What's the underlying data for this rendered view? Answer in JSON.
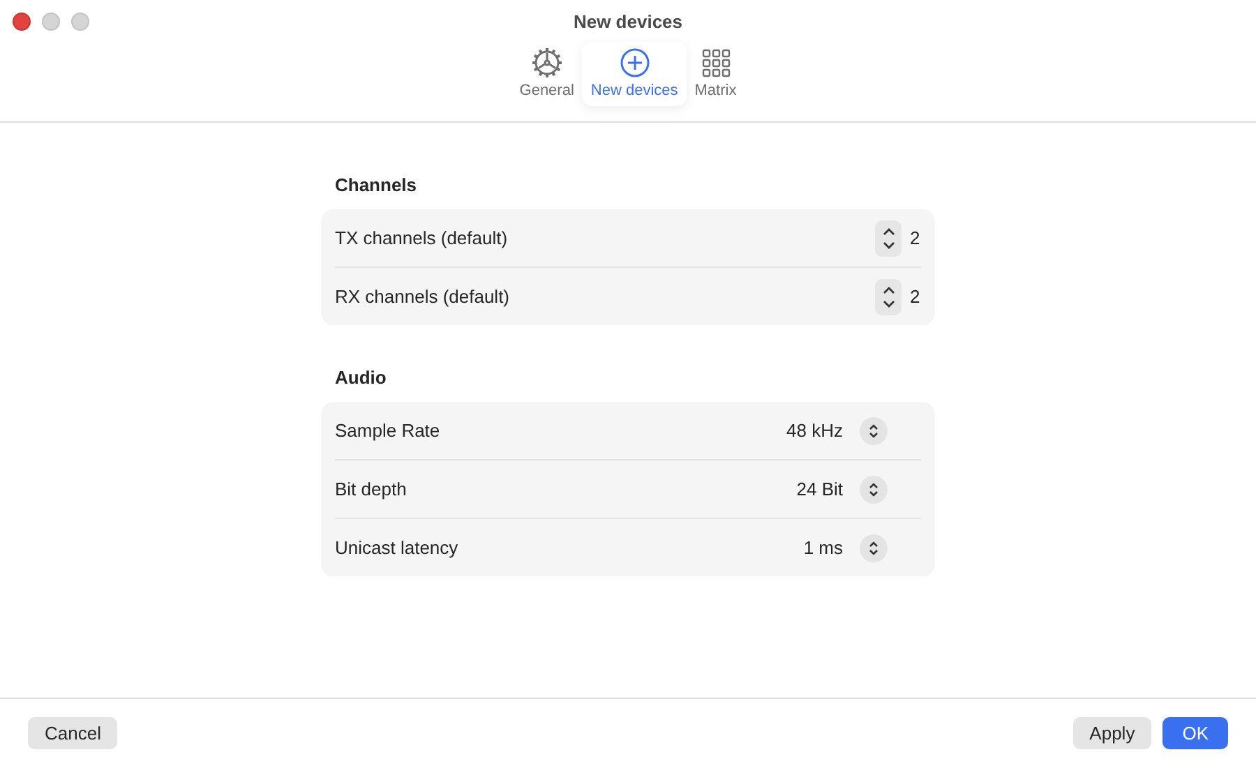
{
  "window": {
    "title": "New devices"
  },
  "tabs": [
    {
      "label": "General",
      "selected": false
    },
    {
      "label": "New devices",
      "selected": true
    },
    {
      "label": "Matrix",
      "selected": false
    }
  ],
  "sections": [
    {
      "title": "Channels",
      "rows": [
        {
          "kind": "stepper",
          "label": "TX channels (default)",
          "value": "2"
        },
        {
          "kind": "stepper",
          "label": "RX channels (default)",
          "value": "2"
        }
      ]
    },
    {
      "title": "Audio",
      "rows": [
        {
          "kind": "popup",
          "label": "Sample Rate",
          "value": "48 kHz"
        },
        {
          "kind": "popup",
          "label": "Bit depth",
          "value": "24 Bit"
        },
        {
          "kind": "popup",
          "label": "Unicast latency",
          "value": "1 ms"
        }
      ]
    }
  ],
  "footer": {
    "left": [
      {
        "label": "Cancel",
        "default": false
      }
    ],
    "right": [
      {
        "label": "Apply",
        "default": false
      },
      {
        "label": "OK",
        "default": true
      }
    ]
  }
}
